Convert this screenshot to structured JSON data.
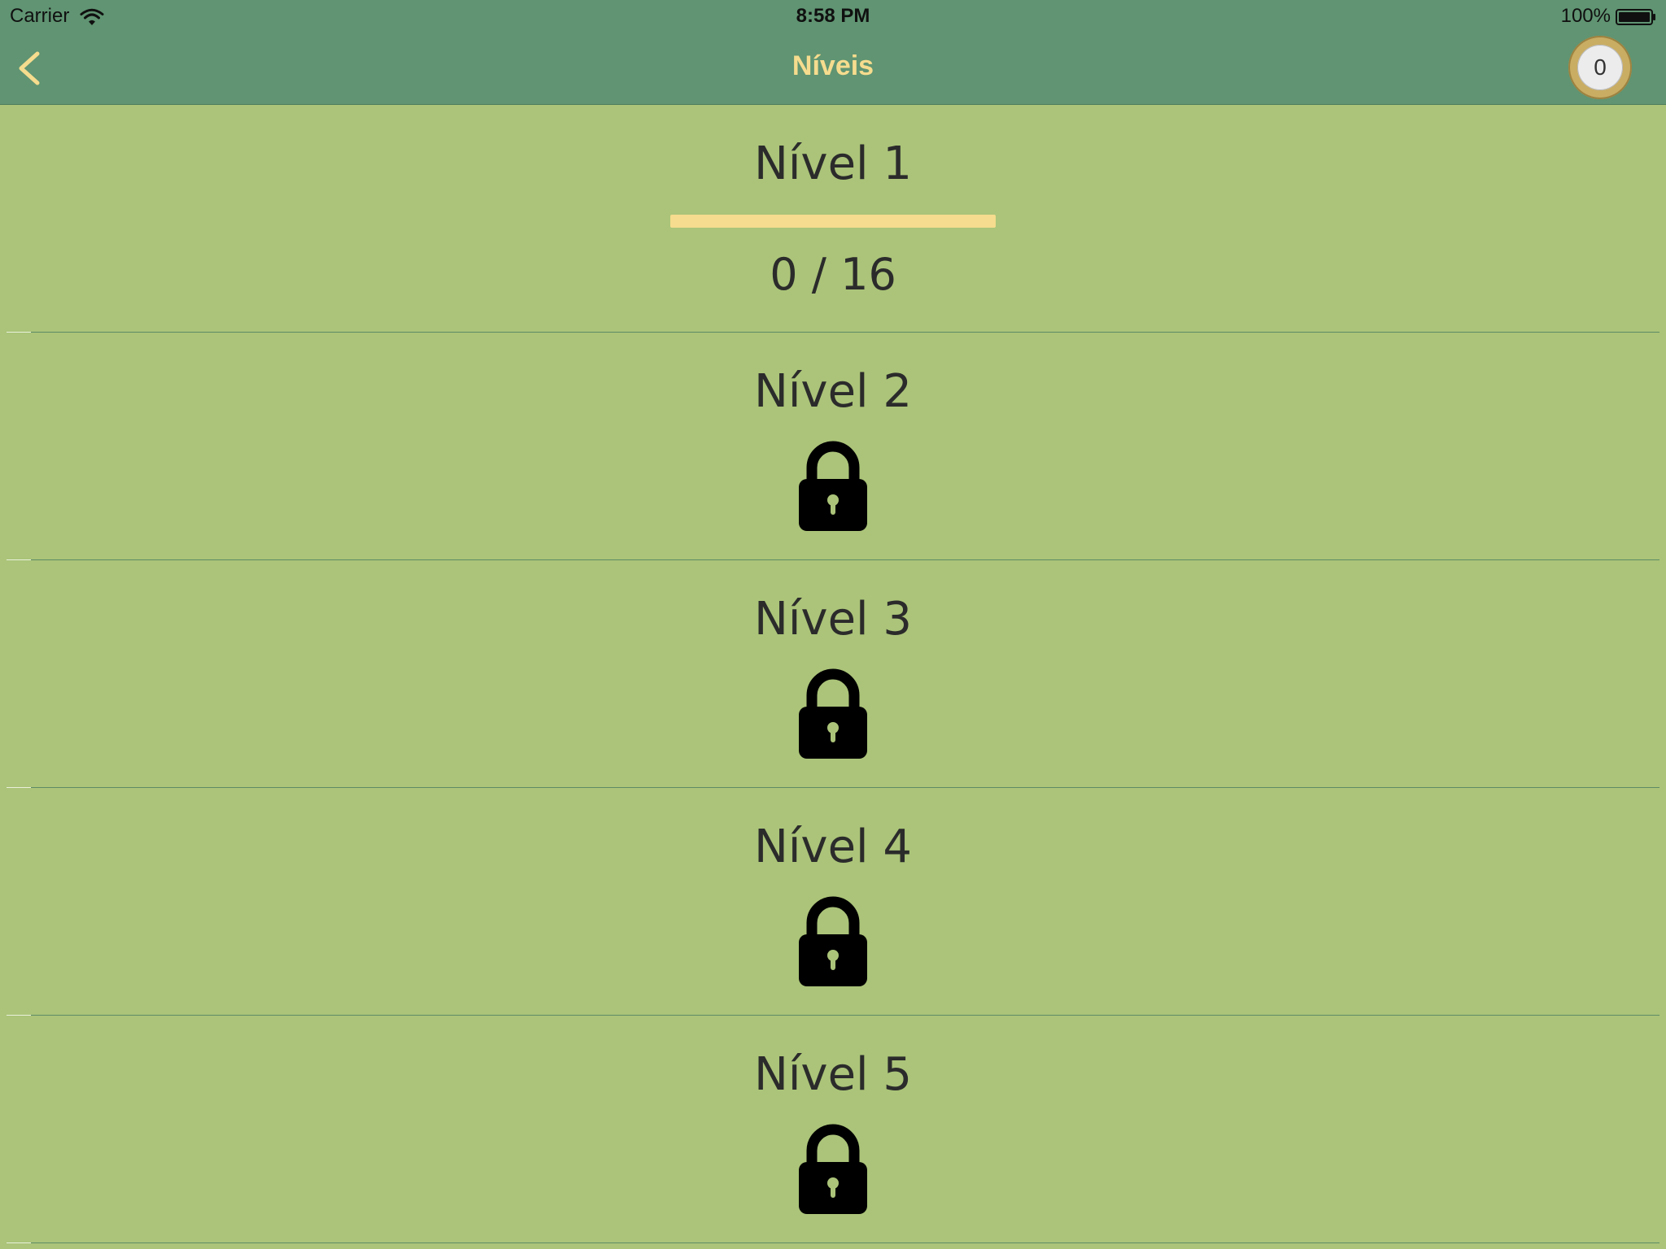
{
  "status_bar": {
    "carrier": "Carrier",
    "time": "8:58 PM",
    "battery_percent": "100%"
  },
  "nav": {
    "title": "Níveis",
    "coins": "0"
  },
  "colors": {
    "bar_background": "#609472",
    "page_background": "#abc479",
    "accent_yellow": "#f6dc8e",
    "text_dark": "#2b2b2b"
  },
  "levels": [
    {
      "title": "Nível 1",
      "count": "0 / 16",
      "progress": 0,
      "locked": false
    },
    {
      "title": "Nível 2",
      "locked": true,
      "icon": "lock-icon"
    },
    {
      "title": "Nível 3",
      "locked": true,
      "icon": "lock-icon"
    },
    {
      "title": "Nível 4",
      "locked": true,
      "icon": "lock-icon"
    },
    {
      "title": "Nível 5",
      "locked": true,
      "icon": "lock-icon"
    }
  ]
}
